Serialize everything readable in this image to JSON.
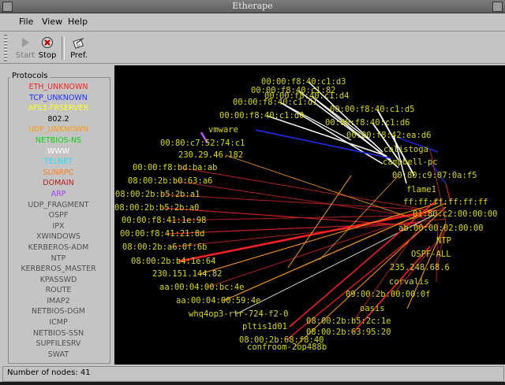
{
  "window": {
    "title": "Etherape"
  },
  "menu": {
    "file": "File",
    "view": "View",
    "help": "Help"
  },
  "toolbar": {
    "start_label": "Start",
    "stop_label": "Stop",
    "pref_label": "Pref."
  },
  "protocols": {
    "header": "Protocols",
    "items": [
      {
        "label": "ETH_UNKNOWN",
        "color": "#ff2020"
      },
      {
        "label": "TCP_UNKNOWN",
        "color": "#2030ff"
      },
      {
        "label": "AFS3-FRSERVER",
        "color": "#ffff20"
      },
      {
        "label": "802.2",
        "color": "#000000"
      },
      {
        "label": "UDP_UNKNOWN",
        "color": "#ff9a10"
      },
      {
        "label": "NETBIOS-NS",
        "color": "#10d010"
      },
      {
        "label": "WWW",
        "color": "#ffffff"
      },
      {
        "label": "TELNET",
        "color": "#20e0ff"
      },
      {
        "label": "SUNRPC",
        "color": "#ff8020"
      },
      {
        "label": "DOMAIN",
        "color": "#b02020"
      },
      {
        "label": "ARP",
        "color": "#a040ff"
      },
      {
        "label": "UDP_FRAGMENT",
        "color": "#505050"
      },
      {
        "label": "OSPF",
        "color": "#505050"
      },
      {
        "label": "IPX",
        "color": "#505050"
      },
      {
        "label": "XWINDOWS",
        "color": "#505050"
      },
      {
        "label": "KERBEROS-ADM",
        "color": "#505050"
      },
      {
        "label": "NTP",
        "color": "#505050"
      },
      {
        "label": "KERBEROS_MASTER",
        "color": "#505050"
      },
      {
        "label": "KPASSWD",
        "color": "#505050"
      },
      {
        "label": "ROUTE",
        "color": "#505050"
      },
      {
        "label": "IMAP2",
        "color": "#505050"
      },
      {
        "label": "NETBIOS-DGM",
        "color": "#505050"
      },
      {
        "label": "ICMP",
        "color": "#505050"
      },
      {
        "label": "NETBIOS-SSN",
        "color": "#505050"
      },
      {
        "label": "SUPFILESRV",
        "color": "#505050"
      },
      {
        "label": "SWAT",
        "color": "#505050"
      }
    ]
  },
  "nodes": [
    "00:00:f8:40:c1:d3",
    "00:00:f8:40:c1:82",
    "00:00:f8:40:c1:d4",
    "00:00:f8:40:c1:d1",
    "00:00:f8:40:c1:d5",
    "00:00:f8:40:c1:d0",
    "00:00:f8:40:c1:d6",
    "vmware",
    "00:00:f8:42:ea:d6",
    "00:80:c7:52:74:c1",
    "calistoga",
    "230.29.46.182",
    "campbell-pc",
    "00:00:f8:bd:ba:ab",
    "00:80:c9:07:0a:f5",
    "08:00:2b:b0:63:a6",
    "flame1",
    "08:00:2b:b5:2b:a1",
    "ff:ff:ff:ff:ff:ff",
    "08:00:2b:b5:2b:a0",
    "01:80:c2:00:00:00",
    "00:00:f8:41:1e:98",
    "ab:00:00:02:00:00",
    "00:00:f8:41:21:8d",
    "NTP",
    "08:00:2b:a6:0f:6b",
    "OSPF-ALL",
    "08:00:2b:b4:1e:64",
    "235.248.68.6",
    "230.151.144.82",
    "corvalis",
    "aa:00:04:00:bc:4e",
    "09:00:2b:00:00:0f",
    "aa:00:04:00:59:4e",
    "oasis",
    "whq4op3-rtr-724-f2-0",
    "08:00:2b:b5:2c:1e",
    "pltis1d01",
    "08:00:2b:63:95:20",
    "08:00:2b:68:f8:40",
    "confroom-2op488b"
  ],
  "status": {
    "nodes_text": "Number of nodes: 41"
  },
  "colors": {
    "canvas_bg": "#000000",
    "node_label": "#d8d810",
    "chrome": "#c4c4c4"
  },
  "icons": {
    "start": "play-icon",
    "stop": "stop-icon",
    "pref": "preferences-icon"
  }
}
